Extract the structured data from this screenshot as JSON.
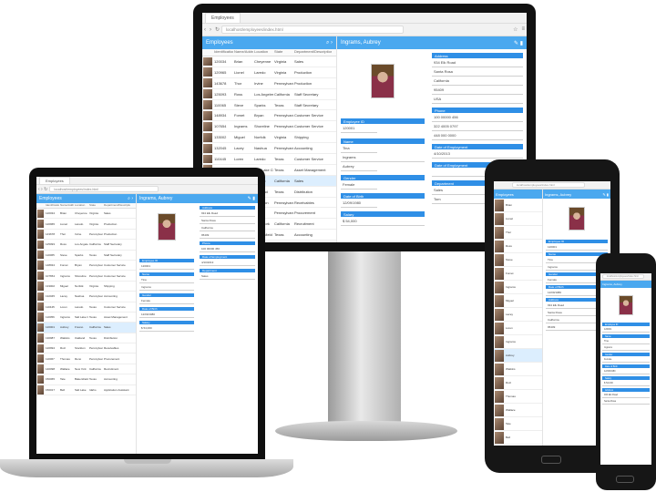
{
  "browser": {
    "tab_title": "Employees",
    "url": "localhost/employees/index.html"
  },
  "list_header": {
    "title": "Employees"
  },
  "detail_header": {
    "name": "Ingrams, Aubrey"
  },
  "columns": [
    "Identification",
    "Name/Address",
    "Location",
    "State",
    "Department/Description"
  ],
  "rows": [
    {
      "id": "120034",
      "name": "Brian",
      "loc": "Cheyenne",
      "state": "Virginia",
      "dept": "Sales"
    },
    {
      "id": "120965",
      "name": "Lionel",
      "loc": "Laredo",
      "state": "Virginia",
      "dept": "Production"
    },
    {
      "id": "143678",
      "name": "Thor",
      "loc": "Irvine",
      "state": "Pennsylvania",
      "dept": "Production"
    },
    {
      "id": "125093",
      "name": "Ross",
      "loc": "Los Angeles",
      "state": "California",
      "dept": "Staff Secretary"
    },
    {
      "id": "110065",
      "name": "Steve",
      "loc": "Sparks",
      "state": "Texas",
      "dept": "Staff Secretary"
    },
    {
      "id": "148934",
      "name": "Fomet",
      "loc": "Bryan",
      "state": "Pennsylvania",
      "dept": "Customer Service"
    },
    {
      "id": "107654",
      "name": "Ingrams",
      "loc": "Shoreline",
      "state": "Pennsylvania",
      "dept": "Customer Service"
    },
    {
      "id": "133002",
      "name": "Miguel",
      "loc": "Norfolk",
      "state": "Virginia",
      "dept": "Shipping"
    },
    {
      "id": "132045",
      "name": "Lacey",
      "loc": "Nashua",
      "state": "Pennsylvania",
      "dept": "Accounting"
    },
    {
      "id": "110445",
      "name": "Loren",
      "loc": "Laredo",
      "state": "Texas",
      "dept": "Customer Service"
    },
    {
      "id": "110056",
      "name": "Ingrams",
      "loc": "Salt Lake City",
      "state": "Texas",
      "dept": "Asset Management"
    },
    {
      "id": "120001",
      "name": "Aubrey",
      "loc": "Fresno",
      "state": "California",
      "dept": "Sales"
    },
    {
      "id": "130987",
      "name": "Watkins",
      "loc": "Oakland",
      "state": "Texas",
      "dept": "Distribution"
    },
    {
      "id": "120994",
      "name": "Ruiz",
      "loc": "Stockton",
      "state": "Pennsylvania",
      "dept": "Receivables"
    },
    {
      "id": "110067",
      "name": "Thomas",
      "loc": "Reno",
      "state": "Pennsylvania",
      "dept": "Procurement"
    },
    {
      "id": "140098",
      "name": "Wallace",
      "loc": "New York",
      "state": "California",
      "dept": "Recruitment"
    },
    {
      "id": "150065",
      "name": "Tate",
      "loc": "Bakersfield",
      "state": "Texas",
      "dept": "Accounting"
    },
    {
      "id": "150017",
      "name": "Bell",
      "loc": "Salt Lake",
      "state": "Idaho",
      "dept": "Application Assistant"
    }
  ],
  "detail": {
    "sections": {
      "employee_id": "Employee ID",
      "name": "Name",
      "gender": "Gender",
      "date_of_birth": "Date of Birth",
      "salary": "Salary",
      "address": "Address",
      "phone": "Phone",
      "date_of_employment": "Date of Employment",
      "date_of_departure": "Date of Employment",
      "department": "Department"
    },
    "values": {
      "employee_id": "120001",
      "first_name": "Tina",
      "last_name": "Ingrams",
      "title": "Aubrey",
      "gender": "Female",
      "dob": "12/09/1980",
      "salary": "$ 54,000",
      "street": "934 Elk Road",
      "city": "Santa Rosa",
      "state": "California",
      "zip": "95409",
      "country": "USA",
      "phone1": "100 00000 456",
      "phone2": "322 4005 0797",
      "phone3": "448 000 0000",
      "employment": "4/10/2013",
      "departure": "",
      "department": "Sales",
      "position": "Tom"
    }
  },
  "colors": {
    "accent": "#4aa8ef",
    "section": "#2f8fe6",
    "selected": "#dceefe"
  }
}
